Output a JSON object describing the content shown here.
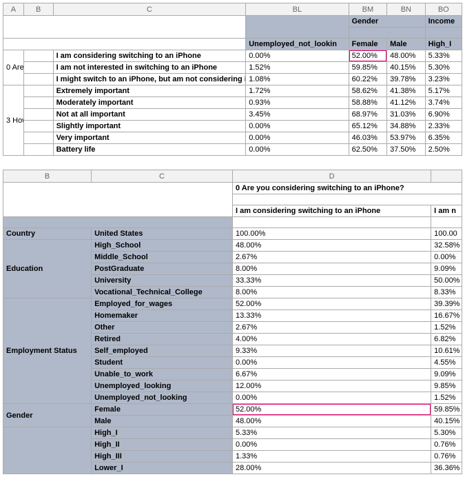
{
  "t1": {
    "cols": {
      "a": "A",
      "b": "B",
      "c": "C",
      "bl": "BL",
      "bm": "BM",
      "bn": "BN",
      "bo": "BO"
    },
    "hdr": {
      "gender": "Gender",
      "income": "Income",
      "un": "Unemployed_not_lookin",
      "female": "Female",
      "male": "Male",
      "highi": "High_I"
    },
    "sidelabels": {
      "r0": "0 Are",
      "r3": "3 How"
    },
    "rows": [
      {
        "q": "I am considering switching to an iPhone",
        "un": "0.00%",
        "f": "52.00%",
        "m": "48.00%",
        "h": "5.33%",
        "hi": "f"
      },
      {
        "q": "I am not interested in switching to an iPhone",
        "un": "1.52%",
        "f": "59.85%",
        "m": "40.15%",
        "h": "5.30%"
      },
      {
        "q": "I might switch to an iPhone, but am not considering it at this tim",
        "un": "1.08%",
        "f": "60.22%",
        "m": "39.78%",
        "h": "3.23%"
      },
      {
        "q": "Extremely important",
        "un": "1.72%",
        "f": "58.62%",
        "m": "41.38%",
        "h": "5.17%"
      },
      {
        "q": "Moderately important",
        "un": "0.93%",
        "f": "58.88%",
        "m": "41.12%",
        "h": "3.74%"
      },
      {
        "q": "Not at all important",
        "un": "3.45%",
        "f": "68.97%",
        "m": "31.03%",
        "h": "6.90%"
      },
      {
        "q": "Slightly important",
        "un": "0.00%",
        "f": "65.12%",
        "m": "34.88%",
        "h": "2.33%"
      },
      {
        "q": "Very important",
        "un": "0.00%",
        "f": "46.03%",
        "m": "53.97%",
        "h": "6.35%"
      },
      {
        "q": "Battery life",
        "un": "0.00%",
        "f": "62.50%",
        "m": "37.50%",
        "h": "2.50%"
      }
    ]
  },
  "t2": {
    "cols": {
      "b": "B",
      "c": "C",
      "d": "D"
    },
    "hdr": {
      "q": "0 Are you considering switching to an iPhone?",
      "a1": "I am considering switching to an iPhone",
      "a2": "I am n"
    },
    "groups": [
      {
        "name": "Country",
        "rows": [
          {
            "l": "United States",
            "v": "100.00%",
            "v2": "100.00"
          }
        ]
      },
      {
        "name": "Education",
        "rows": [
          {
            "l": "High_School",
            "v": "48.00%",
            "v2": "32.58%"
          },
          {
            "l": "Middle_School",
            "v": "2.67%",
            "v2": "0.00%"
          },
          {
            "l": "PostGraduate",
            "v": "8.00%",
            "v2": "9.09%"
          },
          {
            "l": "University",
            "v": "33.33%",
            "v2": "50.00%"
          },
          {
            "l": "Vocational_Technical_College",
            "v": "8.00%",
            "v2": "8.33%"
          }
        ]
      },
      {
        "name": "Employment Status",
        "rows": [
          {
            "l": "Employed_for_wages",
            "v": "52.00%",
            "v2": "39.39%"
          },
          {
            "l": "Homemaker",
            "v": "13.33%",
            "v2": "16.67%"
          },
          {
            "l": "Other",
            "v": "2.67%",
            "v2": "1.52%"
          },
          {
            "l": "Retired",
            "v": "4.00%",
            "v2": "6.82%"
          },
          {
            "l": "Self_employed",
            "v": "9.33%",
            "v2": "10.61%"
          },
          {
            "l": "Student",
            "v": "0.00%",
            "v2": "4.55%"
          },
          {
            "l": "Unable_to_work",
            "v": "6.67%",
            "v2": "9.09%"
          },
          {
            "l": "Unemployed_looking",
            "v": "12.00%",
            "v2": "9.85%"
          },
          {
            "l": "Unemployed_not_looking",
            "v": "0.00%",
            "v2": "1.52%"
          }
        ]
      },
      {
        "name": "Gender",
        "rows": [
          {
            "l": "Female",
            "v": "52.00%",
            "v2": "59.85%",
            "hi": "v"
          },
          {
            "l": "Male",
            "v": "48.00%",
            "v2": "40.15%"
          }
        ]
      },
      {
        "name": "",
        "rows": [
          {
            "l": "High_I",
            "v": "5.33%",
            "v2": "5.30%"
          },
          {
            "l": "High_II",
            "v": "0.00%",
            "v2": "0.76%"
          },
          {
            "l": "High_III",
            "v": "1.33%",
            "v2": "0.76%"
          },
          {
            "l": "Lower_I",
            "v": "28.00%",
            "v2": "36.36%"
          }
        ]
      }
    ]
  }
}
